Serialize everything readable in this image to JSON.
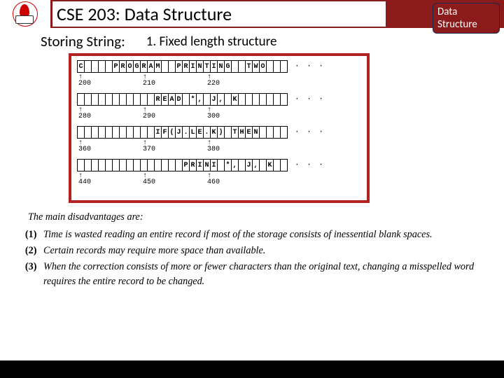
{
  "header": {
    "title": "CSE 203: Data Structure",
    "badge_line1": "Data",
    "badge_line2": "Structure"
  },
  "subtitle": {
    "label": "Storing String:",
    "method": "1.   Fixed length structure"
  },
  "memory": {
    "rows": [
      {
        "cells": [
          "C",
          "",
          "",
          "",
          "",
          "P",
          "R",
          "O",
          "G",
          "R",
          "A",
          "M",
          "",
          "",
          "P",
          "R",
          "I",
          "N",
          "T",
          "I",
          "N",
          "G",
          "",
          "",
          "T",
          "W",
          "O",
          "",
          "",
          ""
        ],
        "dots": "· · ·",
        "addrs": [
          {
            "pos": 0,
            "v": "200"
          },
          {
            "pos": 10,
            "v": "210"
          },
          {
            "pos": 20,
            "v": "220"
          }
        ]
      },
      {
        "cells": [
          "",
          "",
          "",
          "",
          "",
          "",
          "",
          "",
          "",
          "",
          "",
          "R",
          "E",
          "A",
          "D",
          "",
          "*",
          ",",
          "",
          "J",
          ",",
          "",
          "K",
          "",
          "",
          "",
          "",
          "",
          "",
          ""
        ],
        "dots": "· · ·",
        "addrs": [
          {
            "pos": 0,
            "v": "280"
          },
          {
            "pos": 10,
            "v": "290"
          },
          {
            "pos": 20,
            "v": "300"
          }
        ]
      },
      {
        "cells": [
          "",
          "",
          "",
          "",
          "",
          "",
          "",
          "",
          "",
          "",
          "",
          "I",
          "F",
          "(",
          "J",
          ".",
          "L",
          "E",
          ".",
          "K",
          ")",
          "",
          "T",
          "H",
          "E",
          "N",
          "",
          "",
          "",
          ""
        ],
        "dots": "· · ·",
        "addrs": [
          {
            "pos": 0,
            "v": "360"
          },
          {
            "pos": 10,
            "v": "370"
          },
          {
            "pos": 20,
            "v": "380"
          }
        ]
      },
      {
        "cells": [
          "",
          "",
          "",
          "",
          "",
          "",
          "",
          "",
          "",
          "",
          "",
          "",
          "",
          "",
          "",
          "P",
          "R",
          "I",
          "N",
          "I",
          "",
          "*",
          ",",
          "",
          "J",
          ",",
          "",
          "K",
          "",
          ""
        ],
        "dots": "· · ·",
        "addrs": [
          {
            "pos": 0,
            "v": "440"
          },
          {
            "pos": 10,
            "v": "450"
          },
          {
            "pos": 20,
            "v": "460"
          }
        ]
      }
    ]
  },
  "disadvantages": {
    "intro": "The main disadvantages are:",
    "items": [
      "Time is wasted reading an entire record if most of the storage consists of inessential blank spaces.",
      "Certain records may require more space than available.",
      "When the correction consists of more or fewer characters than the original text, changing a misspelled word requires the entire record to be changed."
    ]
  }
}
